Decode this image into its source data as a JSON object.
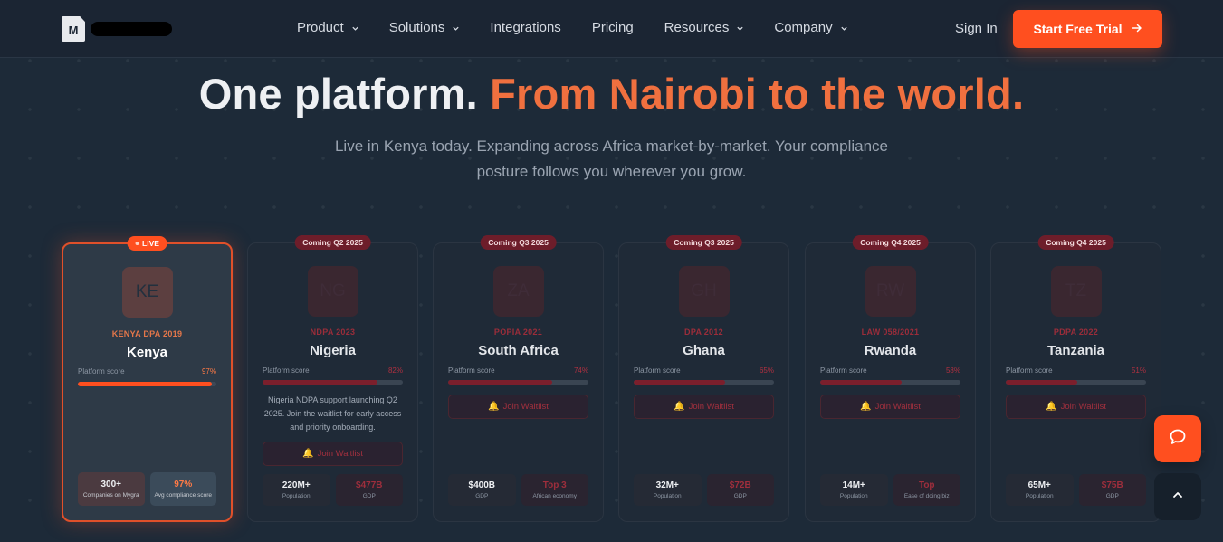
{
  "nav": {
    "logo_mark": "M",
    "links": [
      {
        "label": "Product",
        "dropdown": true
      },
      {
        "label": "Solutions",
        "dropdown": true
      },
      {
        "label": "Integrations",
        "dropdown": false
      },
      {
        "label": "Pricing",
        "dropdown": false
      },
      {
        "label": "Resources",
        "dropdown": true
      },
      {
        "label": "Company",
        "dropdown": true
      }
    ],
    "sign_in": "Sign In",
    "cta": "Start Free Trial"
  },
  "hero": {
    "title_white": "One platform.",
    "title_orange": "From Nairobi to the world.",
    "subtitle": "Live in Kenya today. Expanding across Africa market-by-market. Your compliance posture follows you wherever you grow."
  },
  "cards": [
    {
      "badge": "LIVE",
      "code": "KE",
      "law": "KENYA DPA 2019",
      "country": "Kenya",
      "score_label": "Platform score",
      "score": "97%",
      "score_fraction": 0.97,
      "stats": [
        {
          "value": "300+",
          "label": "Companies on Mygra"
        },
        {
          "value": "97%",
          "label": "Avg compliance score"
        }
      ]
    },
    {
      "badge": "Coming Q2 2025",
      "code": "NG",
      "law": "NDPA 2023",
      "country": "Nigeria",
      "score_label": "Platform score",
      "score": "82%",
      "score_fraction": 0.82,
      "description": "Nigeria NDPA support launching Q2 2025. Join the waitlist for early access and priority onboarding.",
      "waitlist": "Join Waitlist",
      "stats": [
        {
          "value": "220M+",
          "label": "Population"
        },
        {
          "value": "$477B",
          "label": "GDP"
        }
      ]
    },
    {
      "badge": "Coming Q3 2025",
      "code": "ZA",
      "law": "POPIA 2021",
      "country": "South Africa",
      "score_label": "Platform score",
      "score": "74%",
      "score_fraction": 0.74,
      "waitlist": "Join Waitlist",
      "stats": [
        {
          "value": "$400B",
          "label": "GDP"
        },
        {
          "value": "Top 3",
          "label": "African economy"
        }
      ]
    },
    {
      "badge": "Coming Q3 2025",
      "code": "GH",
      "law": "DPA 2012",
      "country": "Ghana",
      "score_label": "Platform score",
      "score": "65%",
      "score_fraction": 0.65,
      "waitlist": "Join Waitlist",
      "stats": [
        {
          "value": "32M+",
          "label": "Population"
        },
        {
          "value": "$72B",
          "label": "GDP"
        }
      ]
    },
    {
      "badge": "Coming Q4 2025",
      "code": "RW",
      "law": "LAW 058/2021",
      "country": "Rwanda",
      "score_label": "Platform score",
      "score": "58%",
      "score_fraction": 0.58,
      "waitlist": "Join Waitlist",
      "stats": [
        {
          "value": "14M+",
          "label": "Population"
        },
        {
          "value": "Top",
          "label": "Ease of doing biz"
        }
      ]
    },
    {
      "badge": "Coming Q4 2025",
      "code": "TZ",
      "law": "PDPA 2022",
      "country": "Tanzania",
      "score_label": "Platform score",
      "score": "51%",
      "score_fraction": 0.51,
      "waitlist": "Join Waitlist",
      "stats": [
        {
          "value": "65M+",
          "label": "Population"
        },
        {
          "value": "$75B",
          "label": "GDP"
        }
      ]
    }
  ],
  "colors": {
    "accent": "#ff4f1f",
    "hero_orange": "#f0703f",
    "background": "#1d2a38",
    "muted_red": "#9b2d3a"
  }
}
